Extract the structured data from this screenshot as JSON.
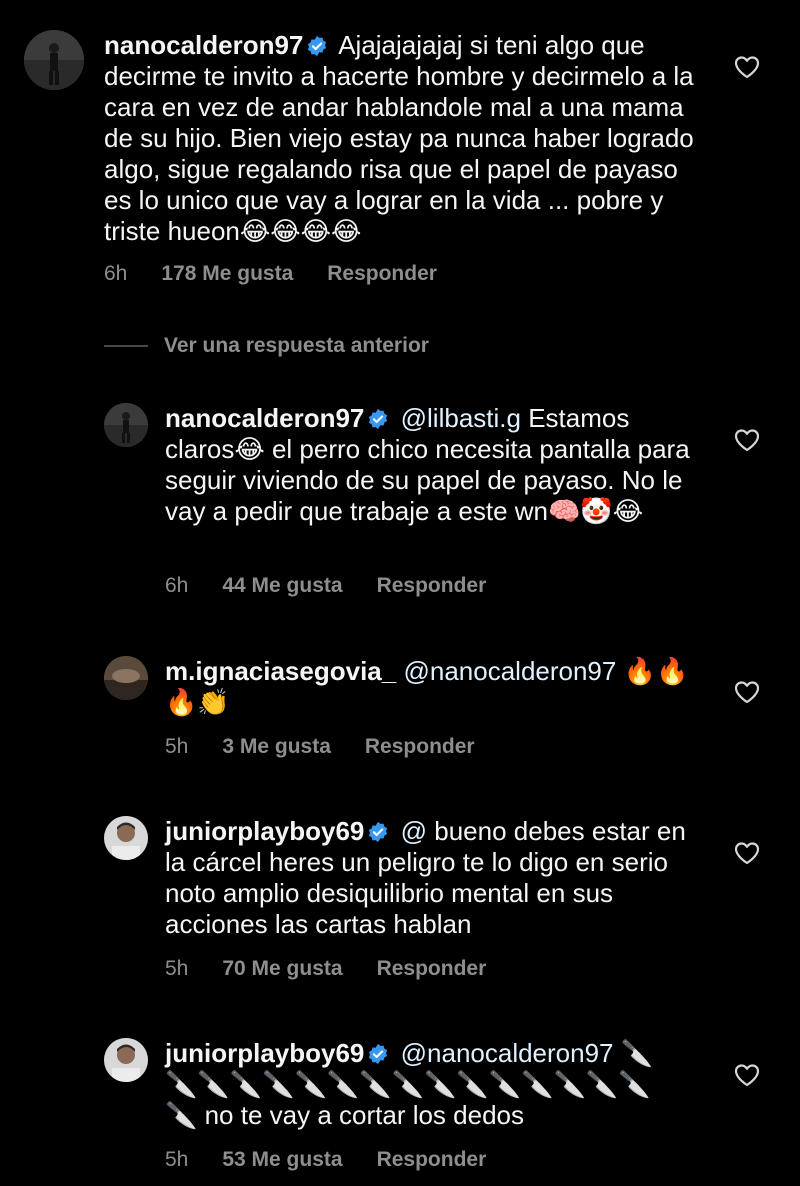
{
  "comments": [
    {
      "username": "nanocalderon97",
      "verified": true,
      "mention": "",
      "text": "Ajajajajajaj si teni algo que decirme te invito a hacerte hombre y decirmelo a la cara en vez de andar hablandole mal a una mama de su hijo. Bien viejo estay pa nunca haber logrado algo, sigue regalando risa que el papel de payaso es lo unico que vay a lograr en la vida ... pobre y triste hueon😂😂😂😂",
      "time": "6h",
      "likes": "178 Me gusta",
      "reply": "Responder"
    },
    {
      "username": "nanocalderon97",
      "verified": true,
      "mention": "@lilbasti.g",
      "text": "Estamos claros😂 el perro chico necesita pantalla para seguir viviendo de su papel de payaso. No le vay a pedir que trabaje a este wn🧠🤡😂",
      "time": "6h",
      "likes": "44 Me gusta",
      "reply": "Responder"
    },
    {
      "username": "m.ignaciasegovia_",
      "verified": false,
      "mention": "@nanocalderon97",
      "text": "🔥🔥🔥👏",
      "time": "5h",
      "likes": "3 Me gusta",
      "reply": "Responder"
    },
    {
      "username": "juniorplayboy69",
      "verified": true,
      "mention": "@",
      "text": "bueno debes estar en la cárcel heres un peligro te lo digo en serio  noto amplio desiquilibrio mental en sus acciones las cartas hablan",
      "time": "5h",
      "likes": "70 Me gusta",
      "reply": "Responder"
    },
    {
      "username": "juniorplayboy69",
      "verified": true,
      "mention": "@nanocalderon97",
      "text": "🔪🔪🔪🔪🔪🔪🔪🔪🔪🔪🔪🔪🔪🔪🔪🔪🔪 no te vay a cortar los dedos",
      "time": "5h",
      "likes": "53 Me gusta",
      "reply": "Responder"
    }
  ],
  "view_previous": "Ver una respuesta anterior",
  "colors": {
    "background": "#000000",
    "text": "#f5f5f5",
    "meta": "#8e8e8e",
    "mention": "#e0f1ff",
    "verified": "#3897f0"
  }
}
